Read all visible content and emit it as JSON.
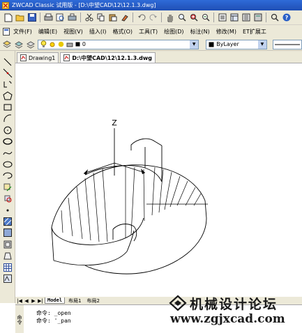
{
  "window": {
    "title": "ZWCAD Classic 试用版 - [D:\\中望CAD\\12\\12.1.3.dwg]"
  },
  "menu": {
    "items": [
      "文件(F)",
      "编辑(E)",
      "视图(V)",
      "插入(I)",
      "格式(O)",
      "工具(T)",
      "绘图(D)",
      "标注(N)",
      "修改(M)",
      "ET扩展工"
    ]
  },
  "layer_bar": {
    "current_layer": "0",
    "color_value": "ByLayer"
  },
  "document_tabs": [
    {
      "label": "Drawing1",
      "active": false
    },
    {
      "label": "D:\\中望CAD\\12\\12.1.3.dwg",
      "active": true
    }
  ],
  "drawing": {
    "axis_label": "Z"
  },
  "layout_tabs": [
    "Model",
    "布局1",
    "布局2"
  ],
  "command": {
    "side_label": "命令",
    "lines": [
      {
        "prompt": "命令:",
        "text": "_open"
      },
      {
        "prompt": "命令:",
        "text": "'_pan"
      }
    ]
  },
  "watermark": {
    "title": "机械设计论坛",
    "url": "www.zgjxcad.com"
  }
}
